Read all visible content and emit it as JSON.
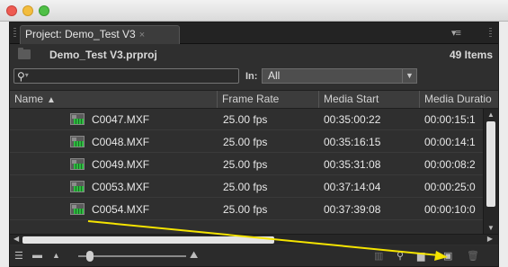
{
  "window": {
    "controls": [
      "close",
      "minimize",
      "zoom"
    ]
  },
  "panel": {
    "tab_title": "Project: Demo_Test V3",
    "tab_close": "×",
    "project_file": "Demo_Test V3.prproj",
    "item_count": "49 Items",
    "menu_icon": "panel-menu-icon"
  },
  "search": {
    "placeholder": "",
    "in_label": "In:",
    "in_value": "All"
  },
  "columns": [
    {
      "label": "Name",
      "sort": "▲"
    },
    {
      "label": "Frame Rate"
    },
    {
      "label": "Media Start"
    },
    {
      "label": "Media Duratio"
    }
  ],
  "rows": [
    {
      "name": "C0047.MXF",
      "frame_rate": "25.00 fps",
      "media_start": "00:35:00:22",
      "media_duration": "00:00:15:1"
    },
    {
      "name": "C0048.MXF",
      "frame_rate": "25.00 fps",
      "media_start": "00:35:16:15",
      "media_duration": "00:00:14:1"
    },
    {
      "name": "C0049.MXF",
      "frame_rate": "25.00 fps",
      "media_start": "00:35:31:08",
      "media_duration": "00:00:08:2"
    },
    {
      "name": "C0053.MXF",
      "frame_rate": "25.00 fps",
      "media_start": "00:37:14:04",
      "media_duration": "00:00:25:0"
    },
    {
      "name": "C0054.MXF",
      "frame_rate": "25.00 fps",
      "media_start": "00:37:39:08",
      "media_duration": "00:00:10:0"
    }
  ],
  "icons": {
    "clip": "video-clip-icon",
    "list_view": "list-view-icon",
    "icon_view": "icon-view-icon",
    "automate": "automate-to-sequence-icon",
    "find": "find-icon",
    "new_bin": "new-bin-icon",
    "new_item": "new-item-icon",
    "delete": "trash-icon"
  },
  "annotation": {
    "color": "#f5e400",
    "meaning": "arrow from C0054.MXF to new-item button"
  }
}
